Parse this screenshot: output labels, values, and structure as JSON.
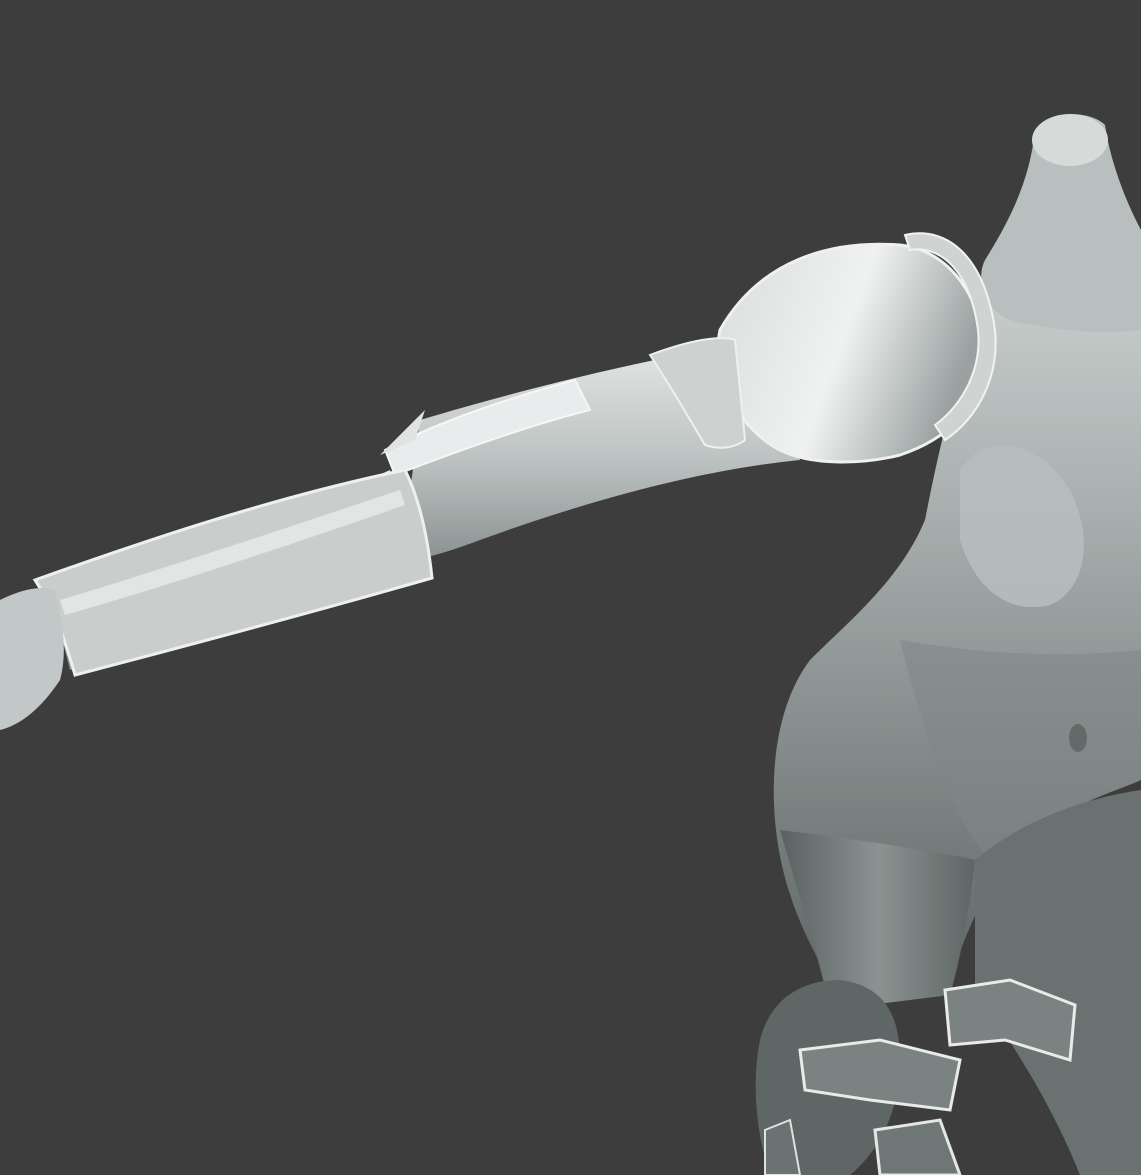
{
  "viewport": {
    "background": "#3d3d3d",
    "subject": "sculpt-render"
  },
  "palette": {
    "skin_light": "#d8dcdc",
    "skin_mid": "#a3aaa9",
    "skin_dark": "#6b7271",
    "armor_light": "#e6e9e8",
    "armor_edge": "#f2f4f3",
    "armor_shadow": "#8e9594"
  }
}
